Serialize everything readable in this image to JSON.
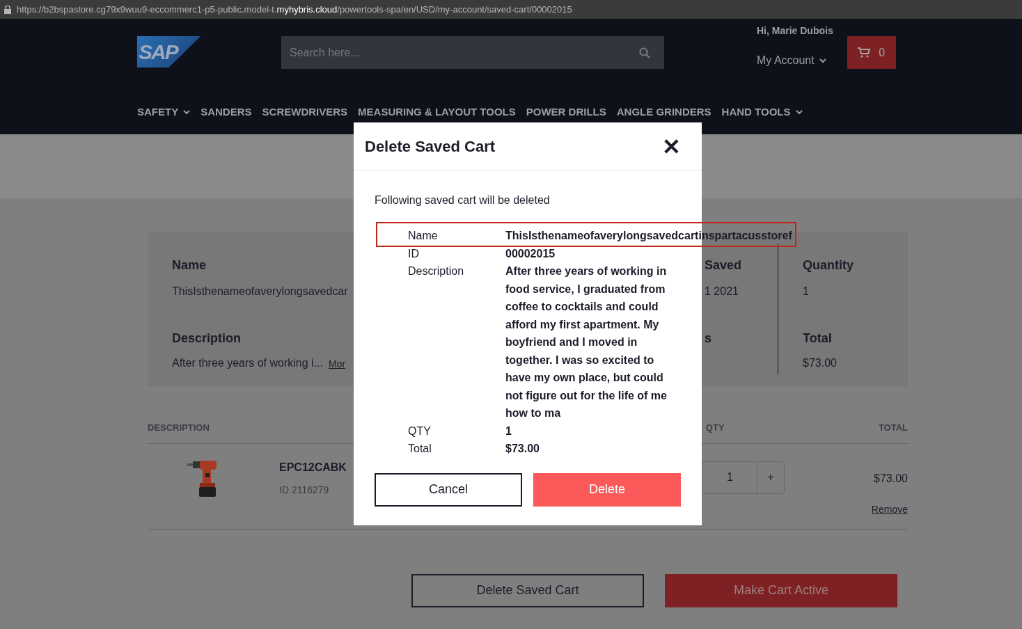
{
  "url_bar": {
    "prefix": "https://b2bspastore.cg79x9wuu9-eccommerc1-p5-public.model-t.",
    "host": "myhybris.cloud",
    "path": "/powertools-spa/en/USD/my-account/saved-cart/00002015"
  },
  "header": {
    "logo": "SAP",
    "search_placeholder": "Search here...",
    "greeting": "Hi, Marie Dubois",
    "account": "My Account",
    "cart_count": "0"
  },
  "nav": [
    {
      "label": "SAFETY",
      "has_dropdown": true
    },
    {
      "label": "SANDERS",
      "has_dropdown": false
    },
    {
      "label": "SCREWDRIVERS",
      "has_dropdown": false
    },
    {
      "label": "MEASURING & LAYOUT TOOLS",
      "has_dropdown": false
    },
    {
      "label": "POWER DRILLS",
      "has_dropdown": false
    },
    {
      "label": "ANGLE GRINDERS",
      "has_dropdown": false
    },
    {
      "label": "HAND TOOLS",
      "has_dropdown": true
    }
  ],
  "summary": {
    "name_label": "Name",
    "name_value": "ThisIsthenameofaverylongsavedcar",
    "description_label": "Description",
    "description_value": "After three years of working i...",
    "more_link": "Mor",
    "date_label": "Saved",
    "date_value": "1 2021",
    "status_label": "s",
    "quantity_label": "Quantity",
    "quantity_value": "1",
    "total_label": "Total",
    "total_value": "$73.00"
  },
  "cart_table": {
    "columns": [
      "DESCRIPTION",
      "QTY",
      "TOTAL"
    ],
    "rows": [
      {
        "product": "EPC12CABK",
        "id": "ID 2116279",
        "qty": "1",
        "plus": "+",
        "total": "$73.00",
        "remove": "Remove"
      }
    ]
  },
  "actions": [
    {
      "label": "Delete Saved Cart",
      "kind": "outline"
    },
    {
      "label": "Make Cart Active",
      "kind": "primary"
    }
  ],
  "modal": {
    "title": "Delete Saved Cart",
    "close": "✕",
    "intro": "Following saved cart will be deleted",
    "fields": [
      {
        "label": "Name",
        "value": "ThisIsthenameofaverylongsavedcartinspartacusstoref",
        "highlighted": true
      },
      {
        "label": "ID",
        "value": "00002015",
        "highlighted": false
      },
      {
        "label": "Description",
        "value": "After three years of working in food service, I graduated from coffee to cocktails and could afford my first apartment. My boyfriend and I moved in together. I was so excited to have my own place, but could not figure out for the life of me how to ma",
        "highlighted": false
      },
      {
        "label": "QTY",
        "value": "1",
        "highlighted": false
      },
      {
        "label": "Total",
        "value": "$73.00",
        "highlighted": false
      }
    ],
    "buttons": [
      {
        "label": "Cancel",
        "kind": "outline"
      },
      {
        "label": "Delete",
        "kind": "primary"
      }
    ]
  }
}
